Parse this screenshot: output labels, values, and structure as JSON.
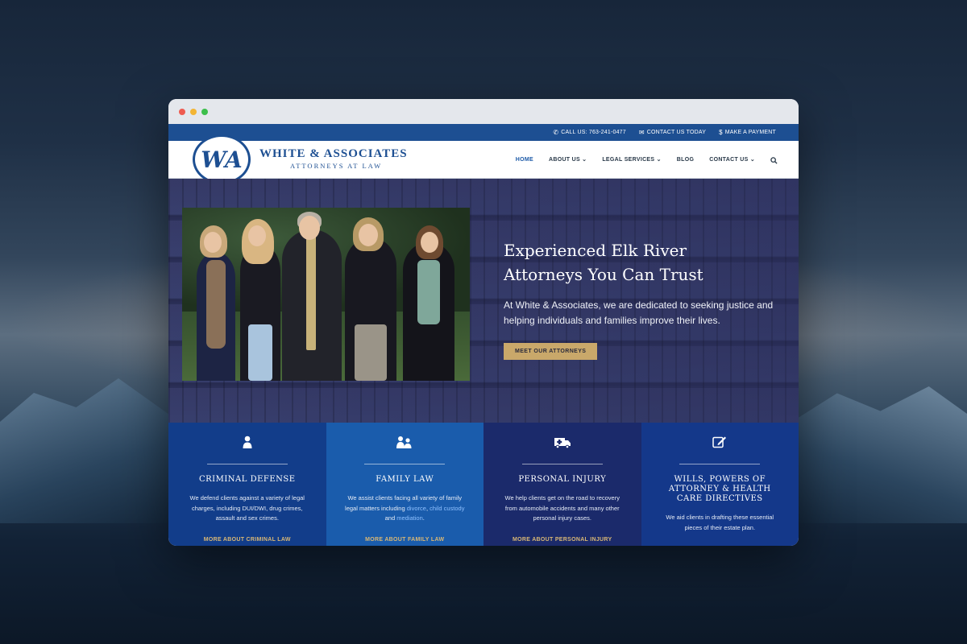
{
  "window": {
    "controls": [
      "close",
      "minimize",
      "maximize"
    ]
  },
  "topbar": {
    "phone": {
      "icon": "phone-icon",
      "label": "CALL US: 763-241-0477"
    },
    "contact": {
      "icon": "chat-icon",
      "label": "CONTACT US TODAY"
    },
    "payment": {
      "icon": "dollar-icon",
      "label": "MAKE A PAYMENT"
    }
  },
  "logo": {
    "monogram": "WA",
    "title": "WHITE & ASSOCIATES",
    "subtitle": "ATTORNEYS AT LAW"
  },
  "nav": {
    "items": [
      {
        "label": "HOME",
        "active": true
      },
      {
        "label": "ABOUT US ⌄"
      },
      {
        "label": "LEGAL SERVICES ⌄"
      },
      {
        "label": "BLOG"
      },
      {
        "label": "CONTACT US ⌄"
      }
    ],
    "search_icon": "search-icon"
  },
  "hero": {
    "title_line1": "Experienced Elk River",
    "title_line2": "Attorneys You Can Trust",
    "description": "At White & Associates, we are dedicated to seeking justice and helping individuals and families improve their lives.",
    "button": "MEET OUR ATTORNEYS"
  },
  "services": [
    {
      "icon": "person-icon",
      "title": "CRIMINAL DEFENSE",
      "desc": "We defend clients against a variety of legal charges, including DUI/DWI, drug crimes, assault and sex crimes.",
      "link": "MORE ABOUT CRIMINAL LAW"
    },
    {
      "icon": "family-icon",
      "title": "FAMILY LAW",
      "desc_before": "We assist clients facing all variety of family legal matters including ",
      "desc_link1": "divorce",
      "desc_sep1": ", ",
      "desc_link2": "child custody",
      "desc_sep2": " and ",
      "desc_link3": "mediation",
      "desc_after": ".",
      "link": "MORE ABOUT FAMILY LAW"
    },
    {
      "icon": "ambulance-icon",
      "title": "PERSONAL INJURY",
      "desc": "We help clients get on the road to recovery from automobile accidents and many other personal injury cases.",
      "link": "MORE ABOUT PERSONAL INJURY"
    },
    {
      "icon": "edit-icon",
      "title": "WILLS, POWERS OF ATTORNEY & HEALTH CARE DIRECTIVES",
      "desc": "We aid clients in drafting these essential pieces of their estate plan.",
      "link": ""
    }
  ]
}
